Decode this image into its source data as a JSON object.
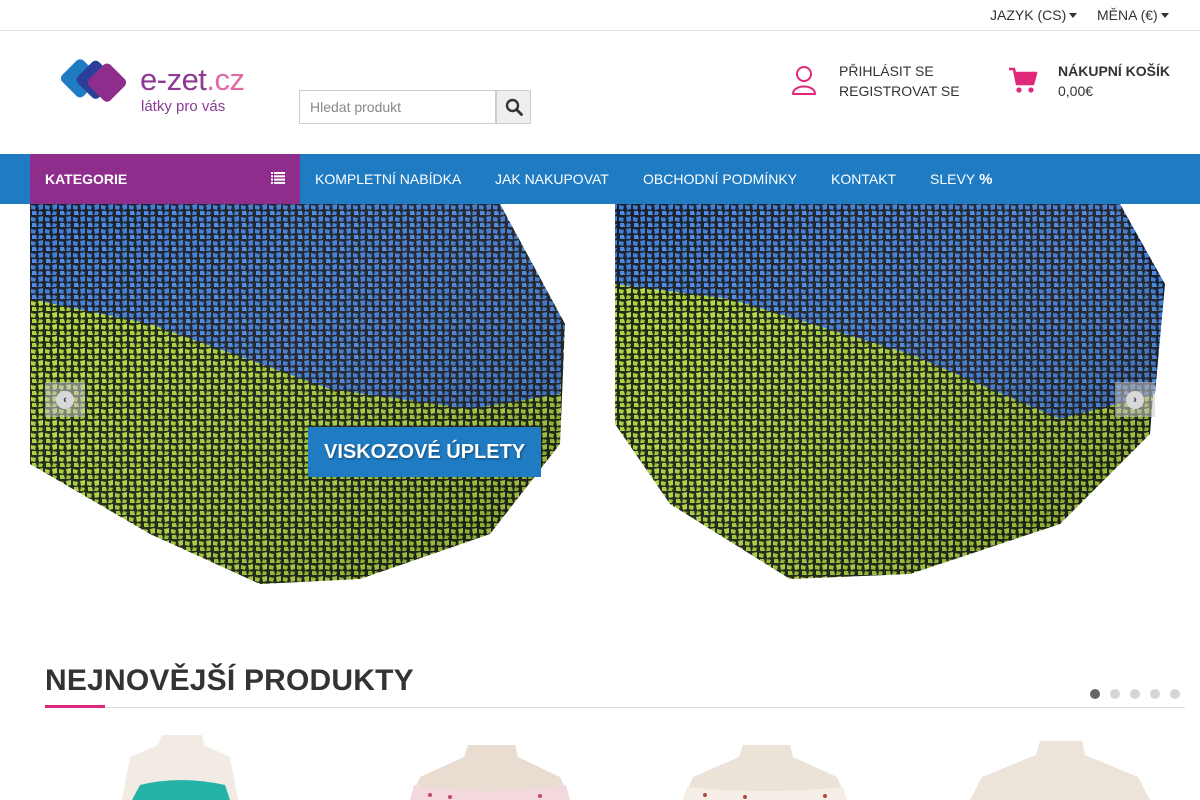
{
  "topbar": {
    "language_label": "JAZYK (CS)",
    "currency_label": "MĚNA (€)"
  },
  "header": {
    "logo": {
      "name": "e-zet",
      "tld": ".cz",
      "tagline": "látky pro vás"
    },
    "search": {
      "placeholder": "Hledat produkt",
      "value": ""
    },
    "account": {
      "login": "PŘIHLÁSIT SE",
      "register": "REGISTROVAT SE"
    },
    "cart": {
      "title": "NÁKUPNÍ KOŠÍK",
      "total": "0,00€"
    }
  },
  "nav": {
    "categories_label": "KATEGORIE",
    "items": [
      {
        "label": "KOMPLETNÍ NABÍDKA"
      },
      {
        "label": "JAK NAKUPOVAT"
      },
      {
        "label": "OBCHODNÍ PODMÍNKY"
      },
      {
        "label": "KONTAKT"
      },
      {
        "label": "SLEVY",
        "icon": "percent-icon"
      }
    ]
  },
  "slider": {
    "caption": "VISKOZOVÉ ÚPLETY",
    "prev_icon": "chevron-left-icon",
    "next_icon": "chevron-right-icon"
  },
  "newest": {
    "title": "NEJNOVĚJŠÍ PRODUKTY",
    "pager_count": 5,
    "active_page": 1
  },
  "colors": {
    "nav_blue": "#1f7bc2",
    "category_purple": "#8f2d8d",
    "accent_pink": "#e0287a",
    "fabric_blue": "#3f7fd6",
    "fabric_green": "#a9d43a"
  }
}
